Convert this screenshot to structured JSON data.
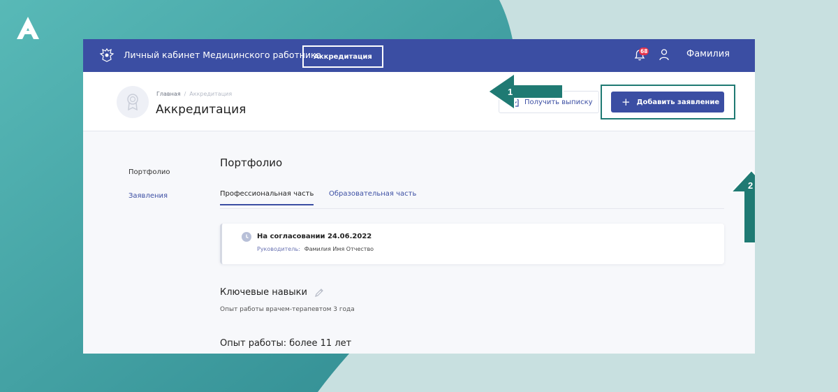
{
  "topbar": {
    "cabinet_title": "Личный кабинет Медицинского работника",
    "accreditation_link": "Аккредитация",
    "notifications_count": "68",
    "user_name": "Фамилия"
  },
  "header": {
    "breadcrumb": {
      "home": "Главная",
      "separator": "/",
      "current": "Аккредитация"
    },
    "page_title": "Аккредитация",
    "extract_button": "Получить выписку",
    "add_button": "Добавить заявление"
  },
  "sidebar": {
    "items": [
      {
        "label": "Портфолио"
      },
      {
        "label": "Заявления"
      }
    ]
  },
  "main": {
    "section_title": "Портфолио",
    "tabs": [
      {
        "label": "Профессиональная часть",
        "active": true
      },
      {
        "label": "Образовательная часть",
        "active": false
      }
    ],
    "status_card": {
      "status": "На согласовании 24.06.2022",
      "manager_label": "Руководитель:",
      "manager_name": "Фамилия Имя Отчество"
    },
    "skills": {
      "title": "Ключевые навыки",
      "text": "Опыт работы врачем-терапевтом 3 года"
    },
    "experience_title": "Опыт работы: более 11 лет"
  },
  "annotations": {
    "arrow_1_label": "1",
    "arrow_2_label": "2"
  },
  "colors": {
    "brand_blue": "#3b4ea3",
    "teal": "#1f7a73",
    "badge_red": "#e5334b",
    "background_light": "#c8e0e0",
    "background_dark_teal": "#3d9a9c"
  },
  "icons": [
    "logo-icon",
    "emblem-icon",
    "bell-icon",
    "user-icon",
    "award-icon",
    "document-icon",
    "plus-icon",
    "clock-icon",
    "pencil-icon"
  ]
}
